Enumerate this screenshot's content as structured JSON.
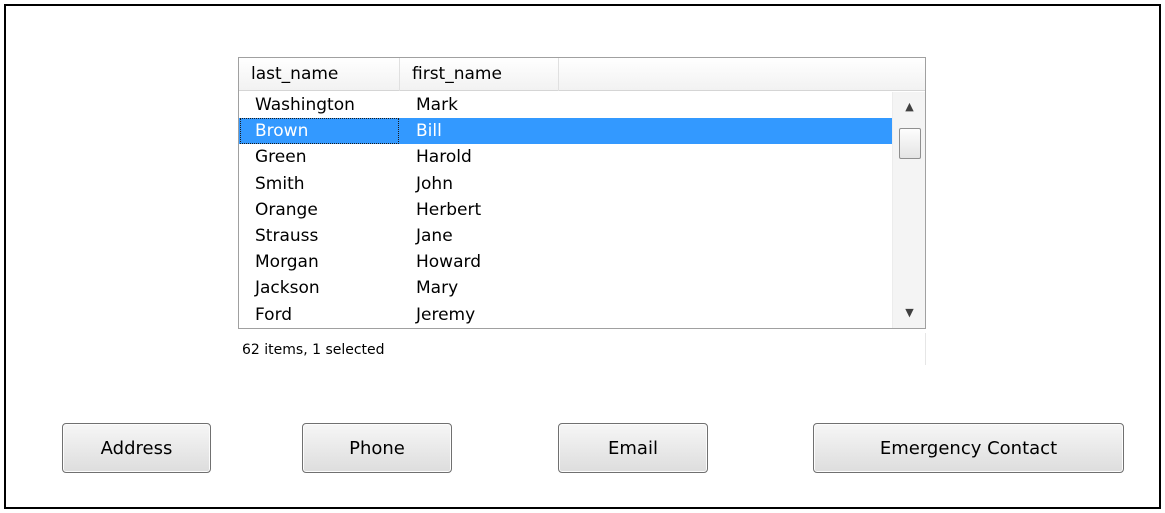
{
  "list": {
    "columns": [
      "last_name",
      "first_name"
    ],
    "rows": [
      {
        "last_name": "Washington",
        "first_name": "Mark"
      },
      {
        "last_name": "Brown",
        "first_name": "Bill",
        "selected": true
      },
      {
        "last_name": "Green",
        "first_name": "Harold"
      },
      {
        "last_name": "Smith",
        "first_name": "John"
      },
      {
        "last_name": "Orange",
        "first_name": "Herbert"
      },
      {
        "last_name": "Strauss",
        "first_name": "Jane"
      },
      {
        "last_name": "Morgan",
        "first_name": "Howard"
      },
      {
        "last_name": "Jackson",
        "first_name": "Mary"
      },
      {
        "last_name": "Ford",
        "first_name": "Jeremy"
      }
    ],
    "selection_color": "#3399ff",
    "scroll_up_icon": "scroll-up-arrow-icon",
    "scroll_down_icon": "scroll-down-arrow-icon"
  },
  "status": {
    "text": "62 items, 1 selected"
  },
  "buttons": {
    "address": "Address",
    "phone": "Phone",
    "email": "Email",
    "emergency": "Emergency Contact"
  }
}
